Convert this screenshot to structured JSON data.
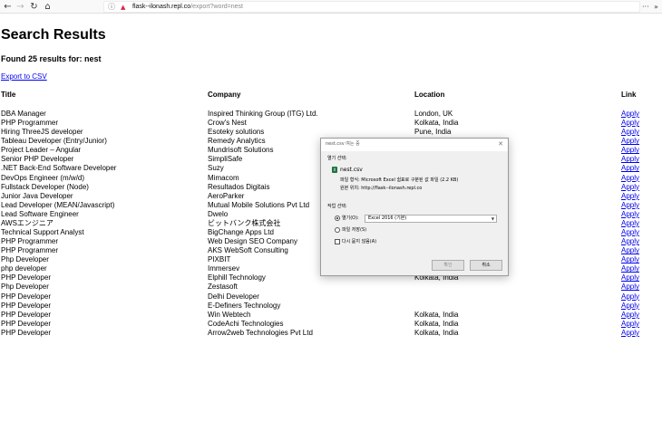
{
  "browser": {
    "url_host": "flask--ilonash.repl.co",
    "url_path": "/export?word=nest",
    "icons": [
      "back-icon",
      "forward-icon",
      "reload-icon",
      "home-icon",
      "shield-icon",
      "lock-icon",
      "menu-icon"
    ]
  },
  "page": {
    "title": "Search Results",
    "summary": "Found 25 results for: nest",
    "export_link": "Export to CSV",
    "headers": {
      "title": "Title",
      "company": "Company",
      "location": "Location",
      "link": "Link"
    }
  },
  "results": [
    {
      "title": "DBA Manager",
      "company": "Inspired Thinking Group (ITG) Ltd.",
      "location": "London, UK",
      "link": "Apply"
    },
    {
      "title": "PHP Programmer",
      "company": "Crow's Nest",
      "location": "Kolkata, India",
      "link": "Apply"
    },
    {
      "title": "Hiring ThreeJS developer",
      "company": "Esoteky solutions",
      "location": "Pune, India",
      "link": "Apply"
    },
    {
      "title": "Tableau Developer (Entry/Junior)",
      "company": "Remedy Analytics",
      "location": "",
      "link": "Apply"
    },
    {
      "title": "Project Leader – Angular",
      "company": "Mundrisoft Solutions",
      "location": "",
      "link": "Apply"
    },
    {
      "title": "Senior PHP Developer",
      "company": "SimpliSafe",
      "location": "",
      "link": "Apply"
    },
    {
      "title": ".NET Back-End Software Developer",
      "company": "Suzy",
      "location": "",
      "link": "Apply"
    },
    {
      "title": "DevOps Engineer (m/w/d)",
      "company": "Mimacom",
      "location": "",
      "link": "Apply"
    },
    {
      "title": "Fullstack Developer (Node)",
      "company": "Resultados Digitais",
      "location": "",
      "link": "Apply"
    },
    {
      "title": "Junior Java Developer",
      "company": "AeroParker",
      "location": "",
      "link": "Apply"
    },
    {
      "title": "Lead Developer (MEAN/Javascript)",
      "company": "Mutual Mobile Solutions Pvt Ltd",
      "location": "",
      "link": "Apply"
    },
    {
      "title": "Lead Software Engineer",
      "company": "Dwelo",
      "location": "",
      "link": "Apply"
    },
    {
      "title": "AWSエンジニア",
      "company": "ビットバンク株式会社",
      "location": "",
      "link": "Apply"
    },
    {
      "title": "Technical Support Analyst",
      "company": "BigChange Apps Ltd",
      "location": "",
      "link": "Apply"
    },
    {
      "title": "PHP Programmer",
      "company": "Web Design SEO Company",
      "location": "",
      "link": "Apply"
    },
    {
      "title": "PHP Programmer",
      "company": "AKS WebSoft Consulting",
      "location": "",
      "link": "Apply"
    },
    {
      "title": "Php Developer",
      "company": "PIXBIT",
      "location": "",
      "link": "Apply"
    },
    {
      "title": "php developer",
      "company": "Immersev",
      "location": "",
      "link": "Apply"
    },
    {
      "title": "PHP Developer",
      "company": "Elphill Technology",
      "location": "Kolkata, India",
      "link": "Apply"
    },
    {
      "title": "Php Developer",
      "company": "Zestasoft",
      "location": "",
      "link": "Apply"
    },
    {
      "title": "PHP Developer",
      "company": "Delhi Developer",
      "location": "",
      "link": "Apply"
    },
    {
      "title": "PHP Developer",
      "company": "E-Definers Technology",
      "location": "",
      "link": "Apply"
    },
    {
      "title": "PHP Developer",
      "company": "Win Webtech",
      "location": "Kolkata, India",
      "link": "Apply"
    },
    {
      "title": "PHP Developer",
      "company": "CodeAchi Technologies",
      "location": "Kolkata, India",
      "link": "Apply"
    },
    {
      "title": "PHP Developer",
      "company": "Arrow2web Technologies Pvt Ltd",
      "location": "Kolkata, India",
      "link": "Apply"
    }
  ],
  "dialog": {
    "title": "nest.csv 여는 중",
    "open_label": "열기 선택:",
    "file_name": "nest.csv",
    "file_type": "파일 형식: Microsoft Excel 쉼표로 구분된 값 파일 (2.2 KB)",
    "file_source": "원본 위치: http://flask--ilonash.repl.co",
    "action_label": "작업 선택:",
    "open_with_label": "열기(O):",
    "open_with_value": "Excel 2016 (기본)",
    "save_label": "파일 저장(S)",
    "remember_label": "다시 묻지 않음(A)",
    "ok_label": "확인",
    "cancel_label": "취소",
    "file_icon_letter": "X",
    "selected_action": "open"
  }
}
